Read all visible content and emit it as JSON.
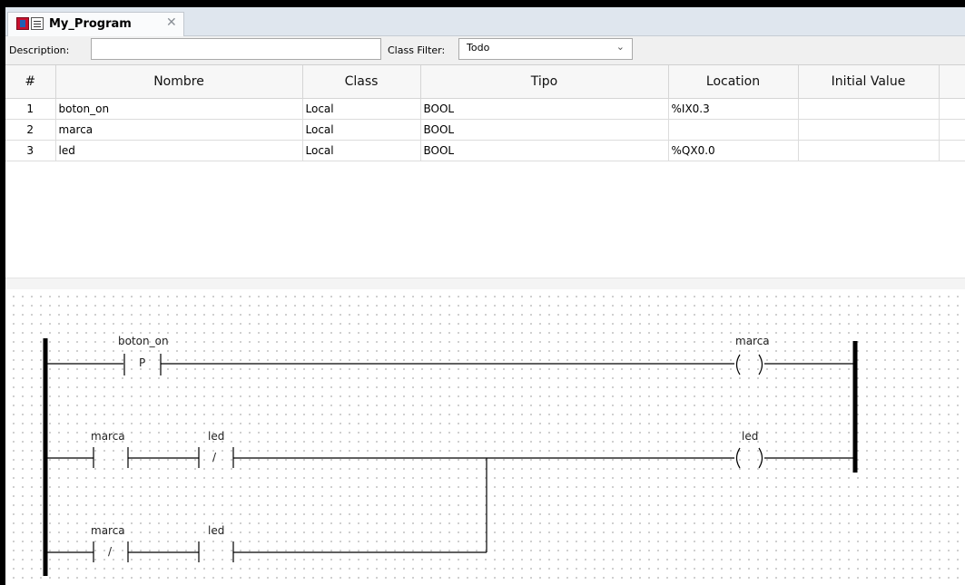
{
  "tab": {
    "title": "My_Program",
    "close_glyph": "✕",
    "icon_1": "program-icon",
    "icon_2": "ladder-icon"
  },
  "filter_bar": {
    "description_label": "Description:",
    "description_value": "",
    "class_filter_label": "Class Filter:",
    "class_filter_value": "Todo"
  },
  "variables_table": {
    "columns": [
      "#",
      "Nombre",
      "Class",
      "Tipo",
      "Location",
      "Initial Value"
    ],
    "rows": [
      {
        "num": "1",
        "nombre": "boton_on",
        "class": "Local",
        "tipo": "BOOL",
        "location": "%IX0.3",
        "initial_value": ""
      },
      {
        "num": "2",
        "nombre": "marca",
        "class": "Local",
        "tipo": "BOOL",
        "location": "",
        "initial_value": ""
      },
      {
        "num": "3",
        "nombre": "led",
        "class": "Local",
        "tipo": "BOOL",
        "location": "%QX0.0",
        "initial_value": ""
      }
    ]
  },
  "ladder": {
    "rung1": {
      "contact": {
        "variable": "boton_on",
        "modifier": "P",
        "kind": "rising-edge"
      },
      "coil": {
        "variable": "marca",
        "kind": "normal"
      }
    },
    "rung2": {
      "contact_a": {
        "variable": "marca",
        "kind": "normally-open"
      },
      "contact_b": {
        "variable": "led",
        "modifier": "/",
        "kind": "normally-closed"
      },
      "coil": {
        "variable": "led",
        "kind": "normal"
      }
    },
    "rung3": {
      "contact_a": {
        "variable": "marca",
        "modifier": "/",
        "kind": "normally-closed"
      },
      "contact_b": {
        "variable": "led",
        "kind": "normally-open"
      }
    }
  }
}
